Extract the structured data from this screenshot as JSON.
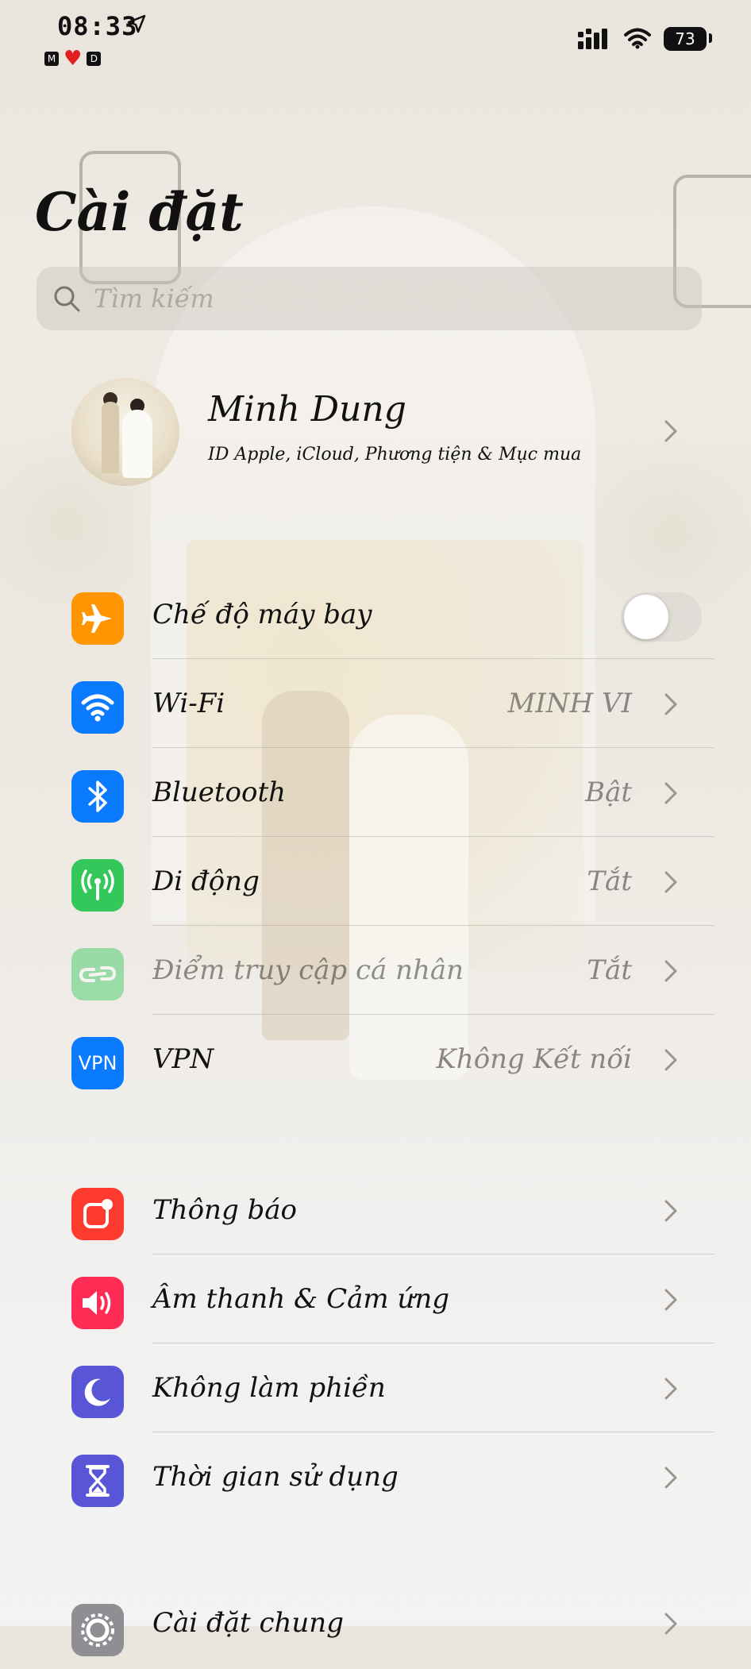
{
  "status_bar": {
    "time": "08:33",
    "indicator_left": "M",
    "indicator_right": "D",
    "battery": "73"
  },
  "page_title": "Cài đặt",
  "search": {
    "placeholder": "Tìm kiếm"
  },
  "profile": {
    "name": "Minh Dung",
    "subtitle": "ID Apple, iCloud, Phương tiện & Mục mua"
  },
  "group1": [
    {
      "label": "Chế độ máy bay",
      "icon": "airplane-icon",
      "color": "#ff9500",
      "toggle_on": false
    },
    {
      "label": "Wi-Fi",
      "value": "MINH VI",
      "icon": "wifi-icon",
      "color": "#0a7aff"
    },
    {
      "label": "Bluetooth",
      "value": "Bật",
      "icon": "bluetooth-icon",
      "color": "#0a7aff"
    },
    {
      "label": "Di động",
      "value": "Tắt",
      "icon": "cellular-icon",
      "color": "#34c759"
    },
    {
      "label": "Điểm truy cập cá nhân",
      "value": "Tắt",
      "icon": "hotspot-icon",
      "color": "#34c759"
    },
    {
      "label": "VPN",
      "value": "Không Kết nối",
      "icon": "vpn-icon",
      "icon_text": "VPN",
      "color": "#0a7aff"
    }
  ],
  "group2": [
    {
      "label": "Thông báo",
      "icon": "notifications-icon",
      "color": "#ff3b30"
    },
    {
      "label": "Âm thanh & Cảm ứng",
      "icon": "sound-icon",
      "color": "#ff2d55"
    },
    {
      "label": "Không làm phiền",
      "icon": "moon-icon",
      "color": "#5856d6"
    },
    {
      "label": "Thời gian sử dụng",
      "icon": "hourglass-icon",
      "color": "#5856d6"
    }
  ],
  "group3": [
    {
      "label": "Cài đặt chung",
      "icon": "gear-icon",
      "color": "#8e8e93"
    }
  ]
}
